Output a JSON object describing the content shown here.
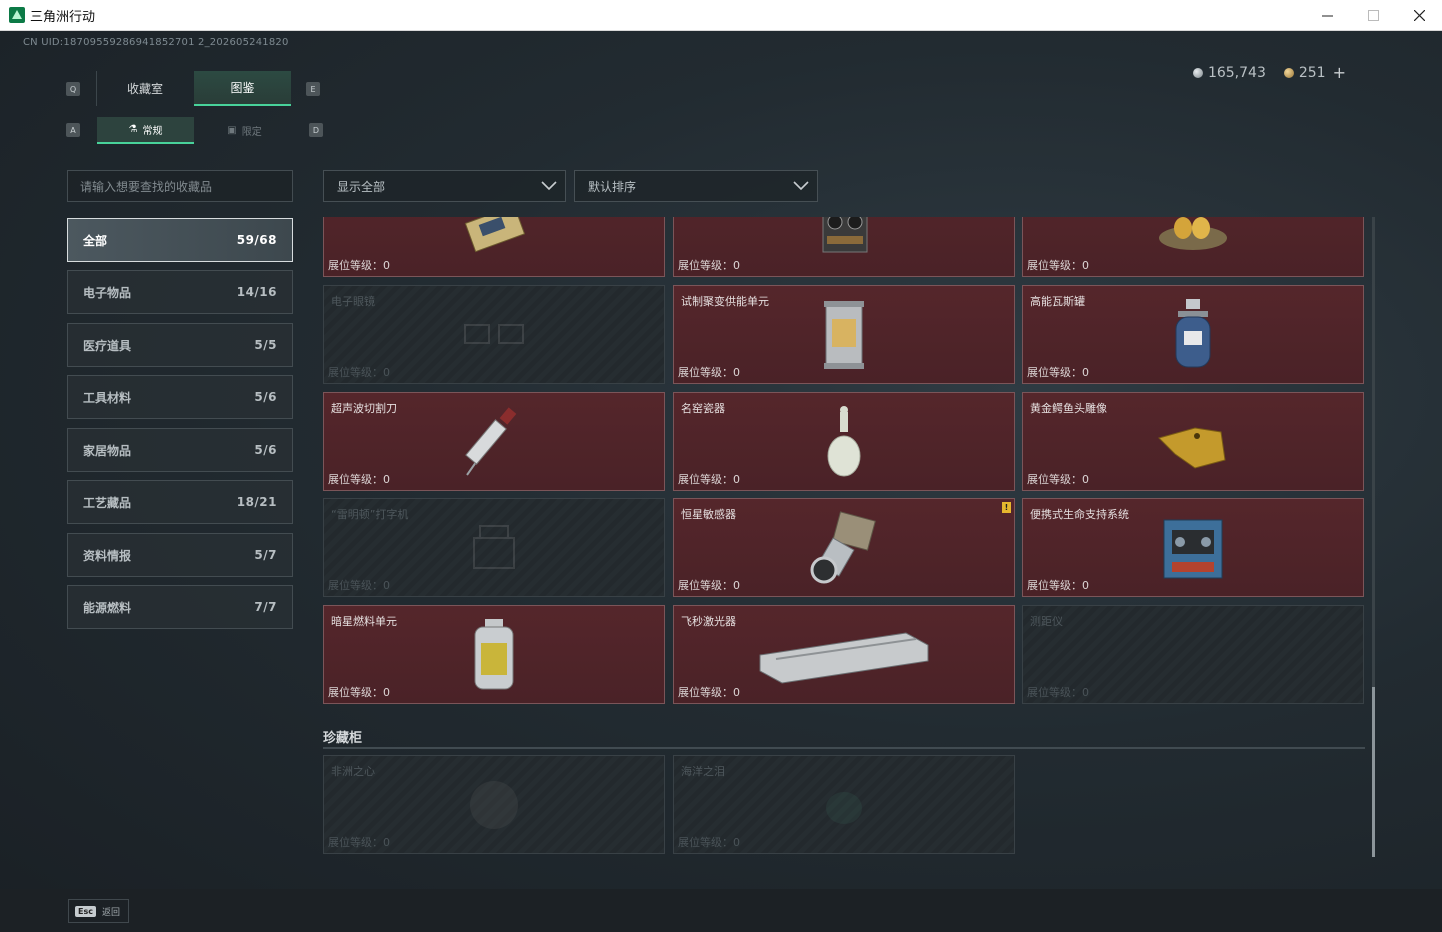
{
  "window": {
    "title": "三角洲行动"
  },
  "uid": "CN UID:18709559286941852701 2_202605241820",
  "currency": {
    "coins": "165,743",
    "tickets": "251",
    "plus": "+"
  },
  "tabs": {
    "left_key": "Q",
    "right_key": "E",
    "sub_left_key": "A",
    "sub_right_key": "D",
    "main": [
      {
        "label": "收藏室",
        "active": false
      },
      {
        "label": "图鉴",
        "active": true
      }
    ],
    "sub": [
      {
        "label": "常规",
        "icon": "flask-icon",
        "active": true
      },
      {
        "label": "限定",
        "icon": "image-icon",
        "active": false
      }
    ]
  },
  "search": {
    "placeholder": "请输入想要查找的收藏品"
  },
  "filters": {
    "display": "显示全部",
    "sort": "默认排序"
  },
  "categories": [
    {
      "label": "全部",
      "count": "59/68",
      "active": true
    },
    {
      "label": "电子物品",
      "count": "14/16"
    },
    {
      "label": "医疗道具",
      "count": "5/5"
    },
    {
      "label": "工具材料",
      "count": "5/6"
    },
    {
      "label": "家居物品",
      "count": "5/6"
    },
    {
      "label": "工艺藏品",
      "count": "18/21"
    },
    {
      "label": "资料情报",
      "count": "5/7"
    },
    {
      "label": "能源燃料",
      "count": "7/7"
    }
  ],
  "level_label": "展位等级：",
  "items": [
    {
      "name": "",
      "level": "0",
      "owned": true,
      "icon": "circuit-board-icon"
    },
    {
      "name": "",
      "level": "0",
      "owned": true,
      "icon": "reel-recorder-icon"
    },
    {
      "name": "",
      "level": "0",
      "owned": true,
      "icon": "golden-eggs-nest-icon"
    },
    {
      "name": "电子眼镜",
      "level": "0",
      "owned": false,
      "icon": "glasses-icon"
    },
    {
      "name": "试制聚变供能单元",
      "level": "0",
      "owned": true,
      "icon": "fusion-unit-icon"
    },
    {
      "name": "高能瓦斯罐",
      "level": "0",
      "owned": true,
      "icon": "gas-canister-icon"
    },
    {
      "name": "超声波切割刀",
      "level": "0",
      "owned": true,
      "icon": "ultrasonic-cutter-icon"
    },
    {
      "name": "名窑瓷器",
      "level": "0",
      "owned": true,
      "icon": "porcelain-vase-icon"
    },
    {
      "name": "黄金鳄鱼头雕像",
      "level": "0",
      "owned": true,
      "icon": "gold-crocodile-icon"
    },
    {
      "name": "“雷明顿”打字机",
      "level": "0",
      "owned": false,
      "icon": "typewriter-icon"
    },
    {
      "name": "恒星敏感器",
      "level": "0",
      "owned": true,
      "icon": "star-sensor-icon",
      "flag": "!"
    },
    {
      "name": "便携式生命支持系统",
      "level": "0",
      "owned": true,
      "icon": "life-support-icon"
    },
    {
      "name": "暗星燃料单元",
      "level": "0",
      "owned": true,
      "icon": "fuel-cell-icon"
    },
    {
      "name": "飞秒激光器",
      "level": "0",
      "owned": true,
      "icon": "laser-device-icon"
    },
    {
      "name": "测距仪",
      "level": "0",
      "owned": false,
      "icon": "rangefinder-icon"
    }
  ],
  "vault": {
    "title": "珍藏柜",
    "items": [
      {
        "name": "非洲之心",
        "level": "0",
        "owned": false,
        "icon": "gem-icon"
      },
      {
        "name": "海洋之泪",
        "level": "0",
        "owned": false,
        "icon": "teardrop-gem-icon"
      }
    ]
  },
  "footer": {
    "esc_key": "Esc",
    "back_label": "返回"
  },
  "colors": {
    "accent": "#48d29a",
    "owned_card": "#55262b",
    "flag": "#e6b72e"
  }
}
